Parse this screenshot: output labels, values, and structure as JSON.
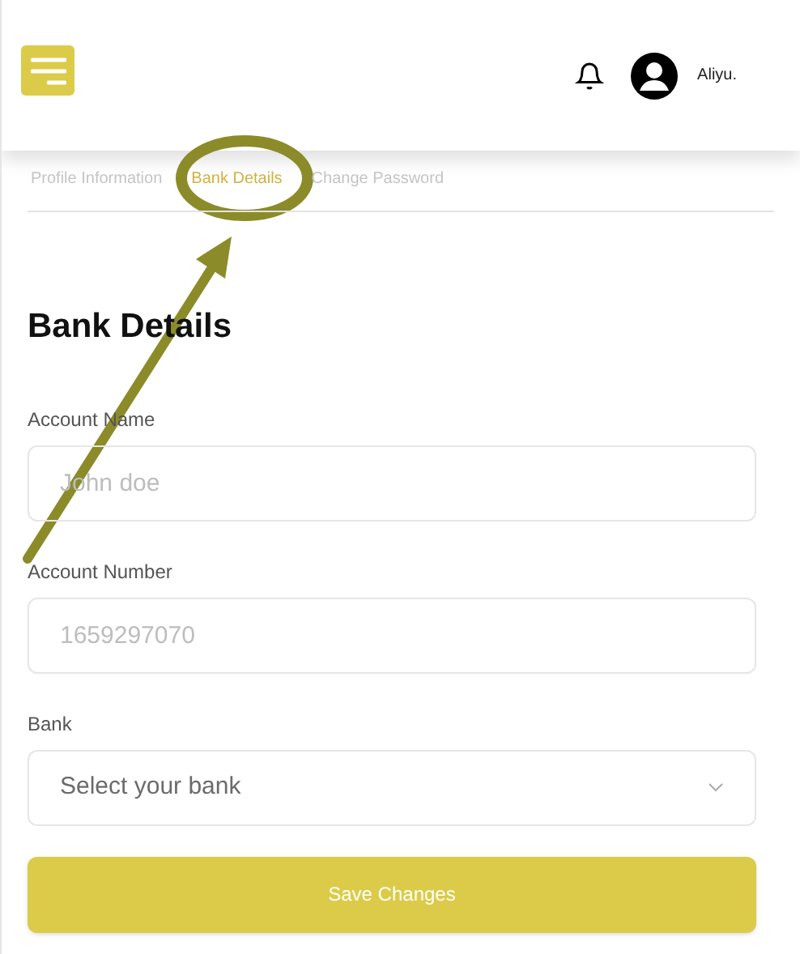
{
  "header": {
    "user_name": "Aliyu."
  },
  "tabs": [
    {
      "label": "Profile Information",
      "selected": false
    },
    {
      "label": "Bank Details",
      "selected": true
    },
    {
      "label": "Change Password",
      "selected": false
    }
  ],
  "heading": "Bank Details",
  "fields": [
    {
      "kind": "input",
      "label": "Account Name",
      "placeholder": "John doe"
    },
    {
      "kind": "input",
      "label": "Account Number",
      "placeholder": "1659297070"
    },
    {
      "kind": "select",
      "label": "Bank",
      "placeholder": "Select your bank"
    }
  ],
  "save_button": "Save Changes"
}
